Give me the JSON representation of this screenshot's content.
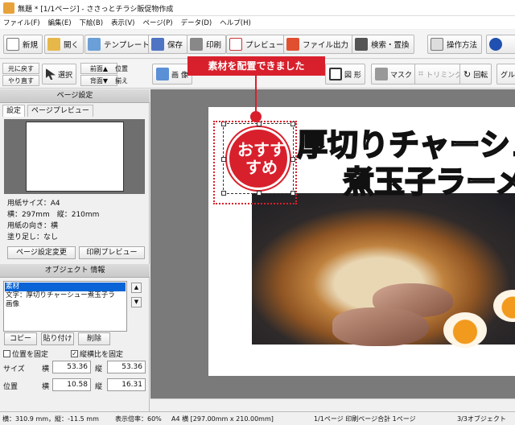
{
  "window": {
    "title": "無題 * [1/1ページ] - ささっとチラシ販促物作成"
  },
  "menu": [
    "ファイル(F)",
    "編集(E)",
    "下絵(B)",
    "表示(V)",
    "ページ(P)",
    "データ(D)",
    "ヘルプ(H)"
  ],
  "toolbar1": {
    "new": "新規",
    "open": "開く",
    "template": "テンプレート",
    "save": "保存",
    "print": "印刷",
    "preview": "プレビュー",
    "file_output": "ファイル出力",
    "search_replace": "検索・置換",
    "how_to": "操作方法"
  },
  "toolbar2": {
    "undo": "元に戻す",
    "redo": "やり直す",
    "select": "選択",
    "bring_front": "前面▲",
    "send_back": "背面▼",
    "align1": "位置",
    "align2": "揃え",
    "image": "画 像",
    "shape": "図 形",
    "mask": "マスク",
    "trimming": "トリミング",
    "rotate": "回転",
    "group": "グル"
  },
  "callout": "素材を配置できました",
  "page_settings": {
    "header": "ページ設定",
    "tab_settings": "設定",
    "tab_preview": "ページプレビュー",
    "paper_size": "用紙サイズ：A4",
    "dimensions": "横：297mm　縦：210mm",
    "orientation": "用紙の向き：横",
    "bleed": "塗り足し：なし",
    "change_button": "ページ設定変更",
    "print_preview_button": "印刷プレビュー"
  },
  "object_info": {
    "header": "オブジェクト 情報",
    "items": [
      "素材",
      "文字：厚切りチャーシュー煮玉子ラ",
      "画像"
    ],
    "copy": "コピー",
    "paste": "貼り付け",
    "delete": "削除",
    "lock_position": "位置を固定",
    "keep_ratio": "縦横比を固定",
    "size_label": "サイズ",
    "pos_label": "位置",
    "w_label": "横",
    "h_label": "縦",
    "size_w": "53.36",
    "size_h": "53.36",
    "pos_x": "10.58",
    "pos_y": "16.31"
  },
  "canvas": {
    "headline1": "厚切りチャーシュ",
    "headline2": "煮玉子ラーメ",
    "stamp_line1": "おすす",
    "stamp_line2": "すめ"
  },
  "status": {
    "cursor": "横：310.9 mm，縦：-11.5 mm",
    "zoom": "表示倍率：60%",
    "paper": "A4 横 [297.00mm x 210.00mm]",
    "pages": "1/1ページ 印刷ページ合計 1ページ",
    "objects": "3/3オブジェクト"
  }
}
